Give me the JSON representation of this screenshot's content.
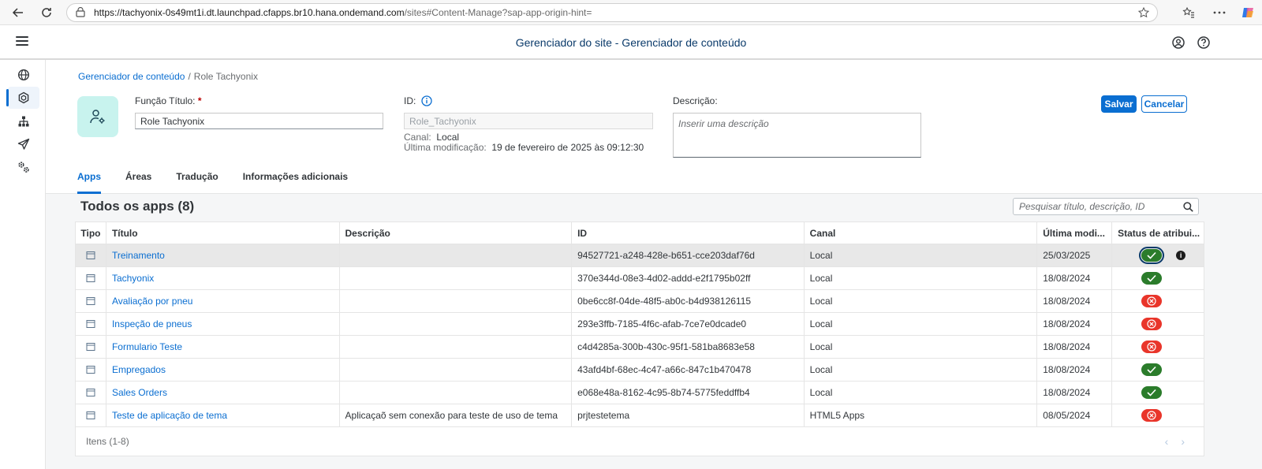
{
  "browser": {
    "url_host": "https://tachyonix-0s49mt1i.dt.launchpad.cfapps.br10.hana.ondemand.com",
    "url_path": "/sites#Content-Manage?sap-app-origin-hint="
  },
  "shell": {
    "title": "Gerenciador do site - Gerenciador de conteúdo"
  },
  "breadcrumb": {
    "parent": "Gerenciador de conteúdo",
    "separator": "/",
    "current": "Role Tachyonix"
  },
  "form": {
    "title_label": "Função Título:",
    "required_mark": "*",
    "title_value": "Role Tachyonix",
    "id_label": "ID:",
    "id_value": "Role_Tachyonix",
    "canal_label": "Canal:",
    "canal_value": "Local",
    "modified_label": "Última modificação:",
    "modified_value": "19 de fevereiro de 2025 às 09:12:30",
    "desc_label": "Descrição:",
    "desc_placeholder": "Inserir uma descrição"
  },
  "actions": {
    "save": "Salvar",
    "cancel": "Cancelar"
  },
  "tabs": [
    {
      "label": "Apps",
      "active": true
    },
    {
      "label": "Áreas",
      "active": false
    },
    {
      "label": "Tradução",
      "active": false
    },
    {
      "label": "Informações adicionais",
      "active": false
    }
  ],
  "apps": {
    "heading": "Todos os apps (8)",
    "search_placeholder": "Pesquisar título, descrição, ID",
    "columns": {
      "tipo": "Tipo",
      "titulo": "Título",
      "descricao": "Descrição",
      "id": "ID",
      "canal": "Canal",
      "modificacao": "Última modi...",
      "status": "Status de atribui..."
    },
    "rows": [
      {
        "titulo": "Treinamento",
        "descricao": "",
        "id": "94527721-a248-428e-b651-cce203daf76d",
        "canal": "Local",
        "modificacao": "25/03/2025",
        "assigned": true
      },
      {
        "titulo": "Tachyonix",
        "descricao": "",
        "id": "370e344d-08e3-4d02-addd-e2f1795b02ff",
        "canal": "Local",
        "modificacao": "18/08/2024",
        "assigned": true
      },
      {
        "titulo": "Avaliação por pneu",
        "descricao": "",
        "id": "0be6cc8f-04de-48f5-ab0c-b4d938126115",
        "canal": "Local",
        "modificacao": "18/08/2024",
        "assigned": false
      },
      {
        "titulo": "Inspeção de pneus",
        "descricao": "",
        "id": "293e3ffb-7185-4f6c-afab-7ce7e0dcade0",
        "canal": "Local",
        "modificacao": "18/08/2024",
        "assigned": false
      },
      {
        "titulo": "Formulario Teste",
        "descricao": "",
        "id": "c4d4285a-300b-430c-95f1-581ba8683e58",
        "canal": "Local",
        "modificacao": "18/08/2024",
        "assigned": false
      },
      {
        "titulo": "Empregados",
        "descricao": "",
        "id": "43afd4bf-68ec-4c47-a66c-847c1b470478",
        "canal": "Local",
        "modificacao": "18/08/2024",
        "assigned": true
      },
      {
        "titulo": "Sales Orders",
        "descricao": "",
        "id": "e068e48a-8162-4c95-8b74-5775feddffb4",
        "canal": "Local",
        "modificacao": "18/08/2024",
        "assigned": true
      },
      {
        "titulo": "Teste de aplicação de tema",
        "descricao": "Aplicaçaõ sem conexão para teste de uso de tema",
        "id": "prjtestetema",
        "canal": "HTML5 Apps",
        "modificacao": "08/05/2024",
        "assigned": false
      }
    ],
    "footer": "Itens (1-8)"
  },
  "colors": {
    "accent": "#0a6ed1",
    "assigned": "#2b7c2b",
    "unassigned": "#e9352a"
  }
}
